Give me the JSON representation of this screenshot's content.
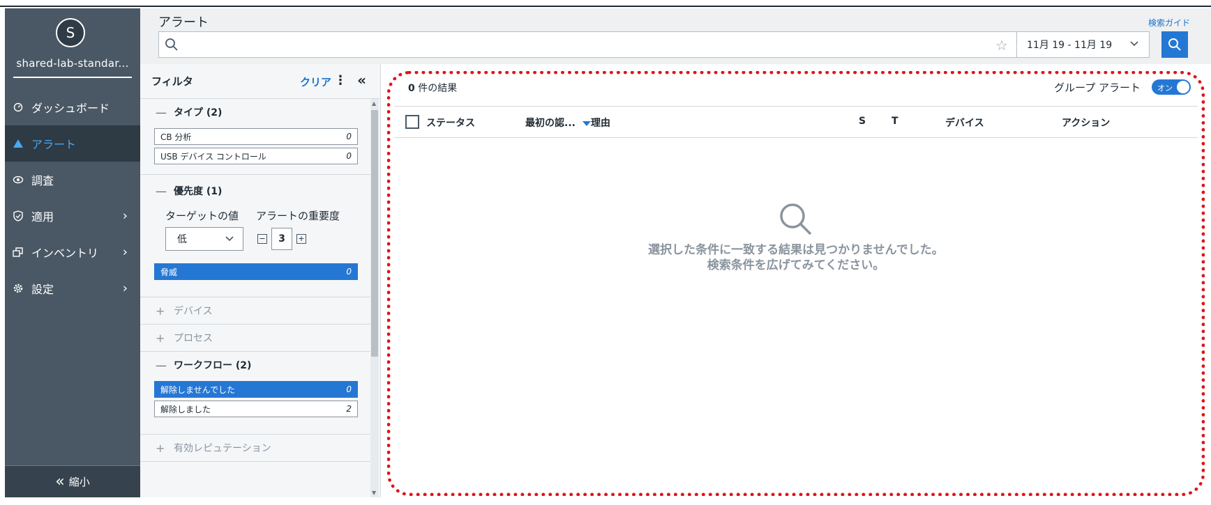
{
  "sidebar": {
    "avatar_letter": "S",
    "org_name": "shared-lab-standar...",
    "items": [
      {
        "label": "ダッシュボード",
        "icon": "dashboard-icon",
        "active": false,
        "has_submenu": false
      },
      {
        "label": "アラート",
        "icon": "alert-triangle-icon",
        "active": true,
        "has_submenu": false
      },
      {
        "label": "調査",
        "icon": "investigate-icon",
        "active": false,
        "has_submenu": false
      },
      {
        "label": "適用",
        "icon": "shield-check-icon",
        "active": false,
        "has_submenu": true
      },
      {
        "label": "インベントリ",
        "icon": "inventory-icon",
        "active": false,
        "has_submenu": true
      },
      {
        "label": "設定",
        "icon": "gear-icon",
        "active": false,
        "has_submenu": true
      }
    ],
    "collapse_label": "縮小"
  },
  "header": {
    "title": "アラート",
    "search_guide": "検索ガイド",
    "search_value": "",
    "date_range": "11月 19 - 11月 19"
  },
  "filters": {
    "title": "フィルタ",
    "clear_label": "クリア",
    "sections": {
      "type": {
        "label": "タイプ (2)",
        "chips": [
          {
            "label": "CB 分析",
            "count": "0"
          },
          {
            "label": "USB デバイス コントロール",
            "count": "0"
          }
        ]
      },
      "priority": {
        "label": "優先度 (1)",
        "target_label": "ターゲットの値",
        "severity_label": "アラートの重要度",
        "target_value": "低",
        "severity_value": "3",
        "chips": [
          {
            "label": "脅威",
            "count": "0"
          }
        ]
      },
      "device": {
        "label": "デバイス"
      },
      "process": {
        "label": "プロセス"
      },
      "workflow": {
        "label": "ワークフロー (2)",
        "chips": [
          {
            "label": "解除しませんでした",
            "count": "0"
          },
          {
            "label": "解除しました",
            "count": "2"
          }
        ]
      },
      "reputation": {
        "label": "有効レピュテーション"
      }
    }
  },
  "main": {
    "results_count": "0",
    "results_suffix": "件の結果",
    "group_alerts_label": "グループ アラート",
    "group_toggle": "オン",
    "columns": {
      "status": "ステータス",
      "first_seen": "最初の認...",
      "reason": "理由",
      "s": "S",
      "t": "T",
      "device": "デバイス",
      "action": "アクション"
    },
    "empty_line1": "選択した条件に一致する結果は見つかりませんでした。",
    "empty_line2": "検索条件を広げてみてください。"
  },
  "colors": {
    "sidebar_bg": "#4a5865",
    "sidebar_active_bg": "#2e3a44",
    "accent": "#2577d4",
    "highlight_border": "#e0141b"
  }
}
